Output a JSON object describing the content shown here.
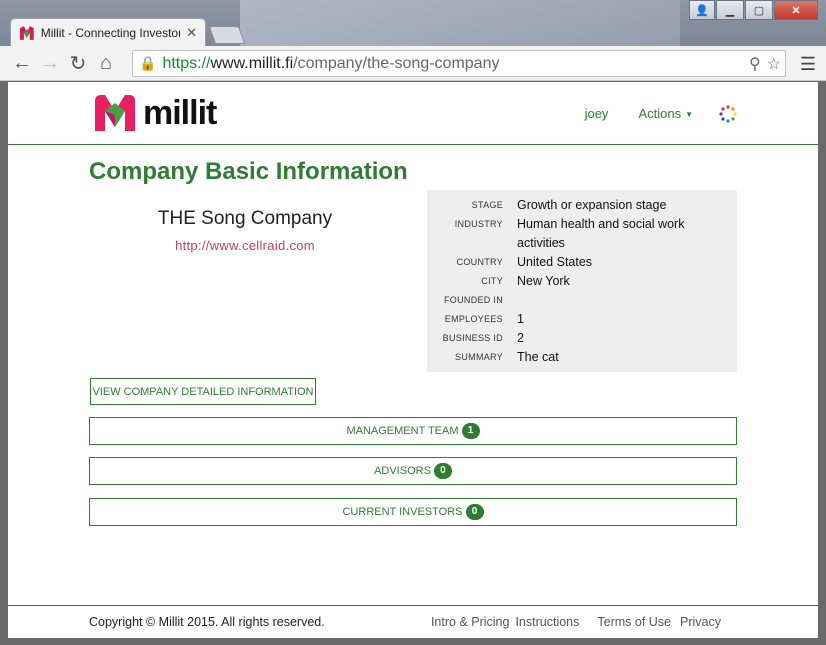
{
  "browser": {
    "tab_title": "Millit - Connecting Investors",
    "url_scheme": "https://",
    "url_host": "www.millit.fi",
    "url_path": "/company/the-song-company"
  },
  "header": {
    "logo_text": "millit",
    "user_link": "joey",
    "actions_label": "Actions"
  },
  "page": {
    "title": "Company Basic Information",
    "company_name": "THE Song Company",
    "company_url": "http://www.cellraid.com"
  },
  "info": [
    {
      "label": "STAGE",
      "value": "Growth or expansion stage"
    },
    {
      "label": "INDUSTRY",
      "value": "Human health and social work activities"
    },
    {
      "label": "COUNTRY",
      "value": "United States"
    },
    {
      "label": "CITY",
      "value": "New York"
    },
    {
      "label": "FOUNDED IN",
      "value": ""
    },
    {
      "label": "EMPLOYEES",
      "value": "1"
    },
    {
      "label": "BUSINESS ID",
      "value": "2"
    },
    {
      "label": "SUMMARY",
      "value": "The cat"
    }
  ],
  "buttons": {
    "detail": "VIEW COMPANY DETAILED INFORMATION",
    "management_label": "MANAGEMENT TEAM",
    "management_count": "1",
    "advisors_label": "ADVISORS",
    "advisors_count": "0",
    "investors_label": "CURRENT INVESTORS",
    "investors_count": "0"
  },
  "footer": {
    "copyright": "Copyright © Millit 2015. All rights reserved.",
    "links": [
      "Intro & Pricing",
      "Instructions",
      "Terms of Use",
      "Privacy"
    ]
  },
  "colors": {
    "brand_green": "#2e7d32",
    "link_red": "#c2405a"
  }
}
